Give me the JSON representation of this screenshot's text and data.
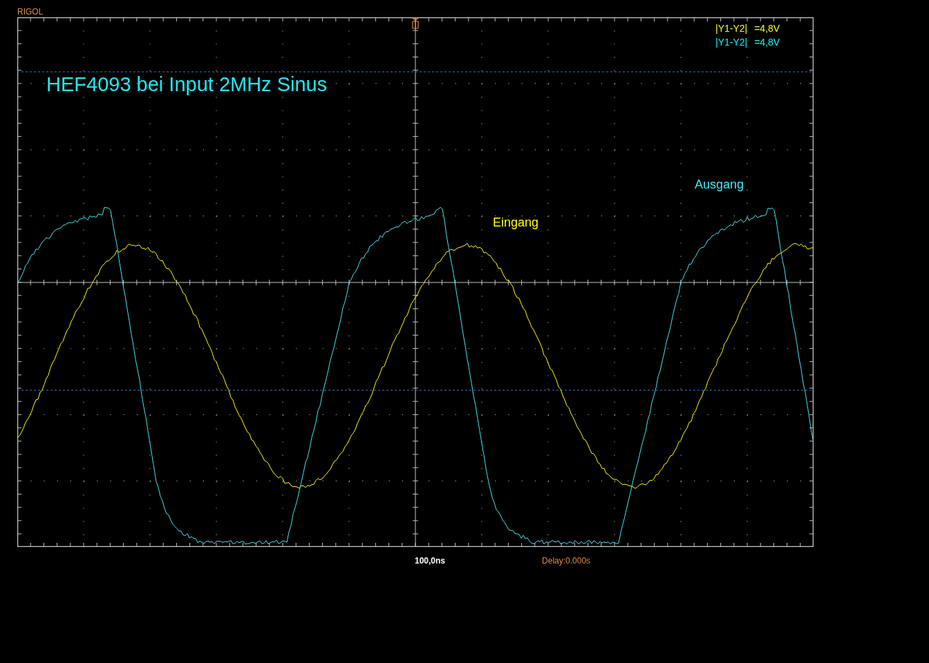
{
  "brand": "RIGOL",
  "plot": {
    "title": "HEF4093 bei Input 2MHz Sinus",
    "measurements": [
      {
        "label": "|Y1-Y2|",
        "value": "=4,8V",
        "color": "#ffff00"
      },
      {
        "label": "|Y1-Y2|",
        "value": "=4,8V",
        "color": "#00ffff"
      }
    ],
    "traces": [
      {
        "label": "Eingang",
        "color": "#ffff00",
        "kind": "sine"
      },
      {
        "label": "Ausgang",
        "color": "#40e8f0",
        "kind": "schmitt"
      }
    ]
  },
  "timebase": "100,0ns",
  "delay": "Delay:0.000s"
}
